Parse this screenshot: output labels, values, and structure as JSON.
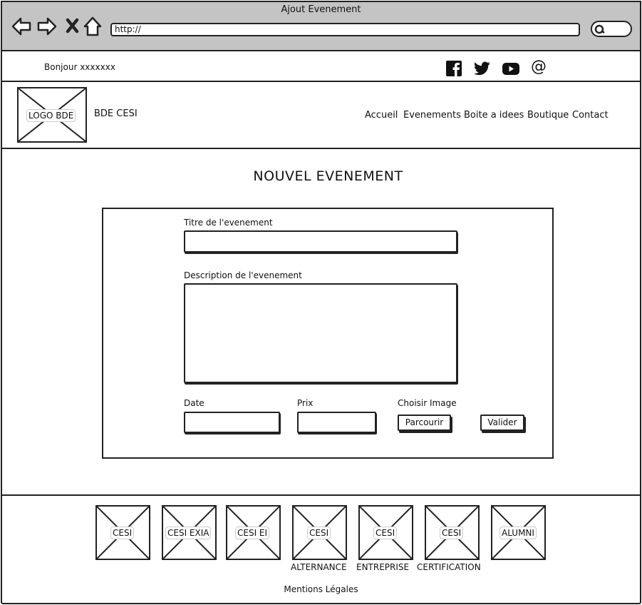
{
  "window": {
    "title": "Ajout Evenement"
  },
  "browser": {
    "url": "http://"
  },
  "topbar": {
    "greeting": "Bonjour xxxxxxx"
  },
  "social": [
    "facebook-icon",
    "twitter-icon",
    "youtube-icon",
    "at-icon"
  ],
  "header": {
    "logo_label": "LOGO BDE",
    "brand": "BDE CESI",
    "nav": [
      "Accueil",
      "Evenements",
      "Boite a idees",
      "Boutique",
      "Contact"
    ]
  },
  "page": {
    "title": "NOUVEL EVENEMENT"
  },
  "form": {
    "title_label": "Titre de l'evenement",
    "title_value": "",
    "description_label": "Description de l'evenement",
    "description_value": "",
    "date_label": "Date",
    "date_value": "",
    "price_label": "Prix",
    "price_value": "",
    "image_label": "Choisir Image",
    "browse_button": "Parcourir",
    "submit_button": "Valider"
  },
  "footer": {
    "partners": [
      {
        "label": "CESI",
        "sub": ""
      },
      {
        "label": "CESI EXIA",
        "sub": ""
      },
      {
        "label": "CESI EI",
        "sub": ""
      },
      {
        "label": "CESI",
        "sub": "ALTERNANCE"
      },
      {
        "label": "CESI",
        "sub": "ENTREPRISE"
      },
      {
        "label": "CESI",
        "sub": "CERTIFICATION"
      },
      {
        "label": "ALUMNI",
        "sub": ""
      }
    ],
    "mentions": "Mentions Légales"
  }
}
